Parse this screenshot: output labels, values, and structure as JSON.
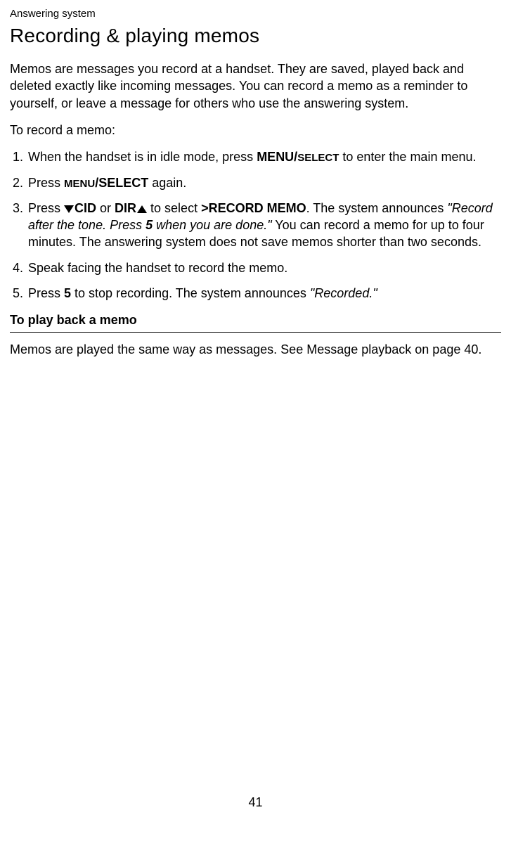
{
  "header": {
    "section": "Answering system"
  },
  "title": "Recording & playing memos",
  "intro": "Memos are messages you record at a handset. They are saved, played back and deleted exactly like incoming messages. You can record a memo as a reminder to yourself, or leave a message for others who use the answering system.",
  "lead": "To record a memo:",
  "steps": {
    "s1a": "When the handset is in idle mode, press ",
    "s1b": "MENU/",
    "s1c": "SELECT",
    "s1d": " to enter the main menu.",
    "s2a": "Press ",
    "s2b": "MENU",
    "s2c": "/SELECT",
    "s2d": " again.",
    "s3a": "Press ",
    "s3cid": "CID",
    "s3or": " or ",
    "s3dir": "DIR",
    "s3sel": " to select ",
    "s3rec": ">RECORD MEMO",
    "s3ann": ". The system announces ",
    "s3quote_a": "\"Record after the tone. Press ",
    "s3quote_b": "5",
    "s3quote_c": " when you are done.\"",
    "s3tail": " You can record a memo for up to four minutes. The answering system does not save memos shorter than two seconds.",
    "s4": "Speak facing the handset to record the memo.",
    "s5a": "Press ",
    "s5b": "5",
    "s5c": " to stop recording. The system announces ",
    "s5d": "\"Recorded.\""
  },
  "subhead": "To play back a memo",
  "playback": "Memos are played the same way as messages. See Message playback on page 40.",
  "page_number": "41"
}
